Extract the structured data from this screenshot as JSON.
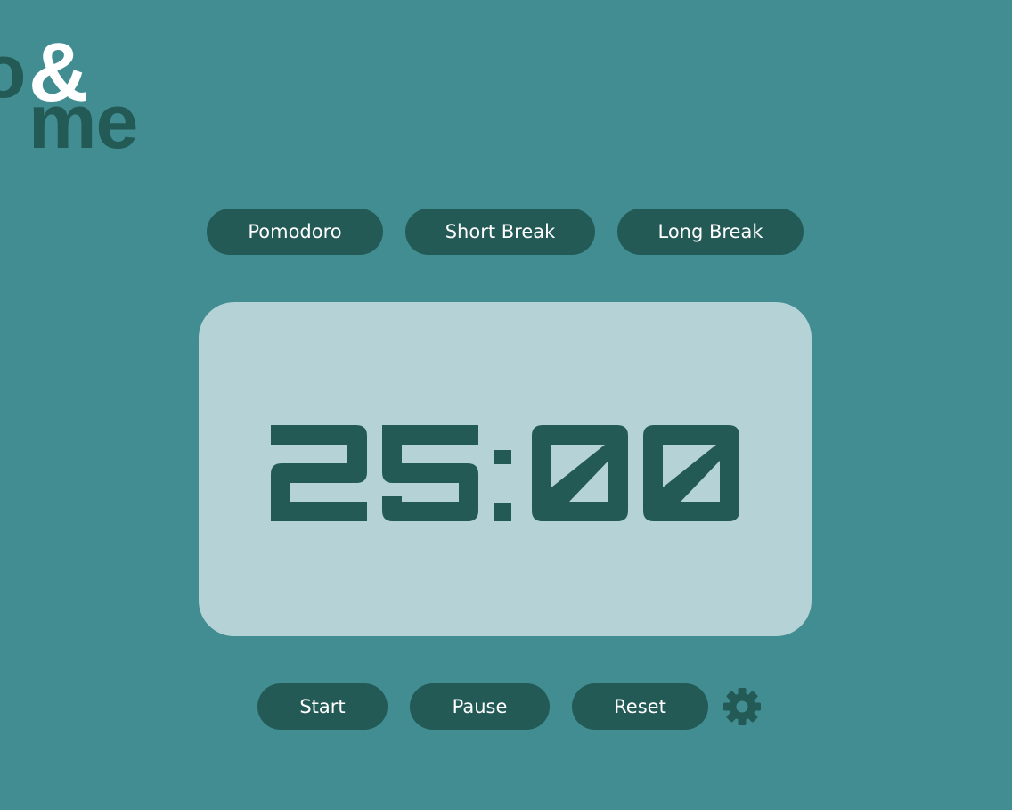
{
  "logo": {
    "part_o": "o",
    "part_amp": "&",
    "part_me": "me"
  },
  "modes": {
    "pomodoro_label": "Pomodoro",
    "short_break_label": "Short Break",
    "long_break_label": "Long Break"
  },
  "timer": {
    "display": "25:00"
  },
  "controls": {
    "start_label": "Start",
    "pause_label": "Pause",
    "reset_label": "Reset",
    "settings_icon": "gear-icon"
  },
  "colors": {
    "background": "#418d91",
    "accent": "#235a56",
    "card": "#b5d3d6",
    "text_on_accent": "#ffffff"
  }
}
